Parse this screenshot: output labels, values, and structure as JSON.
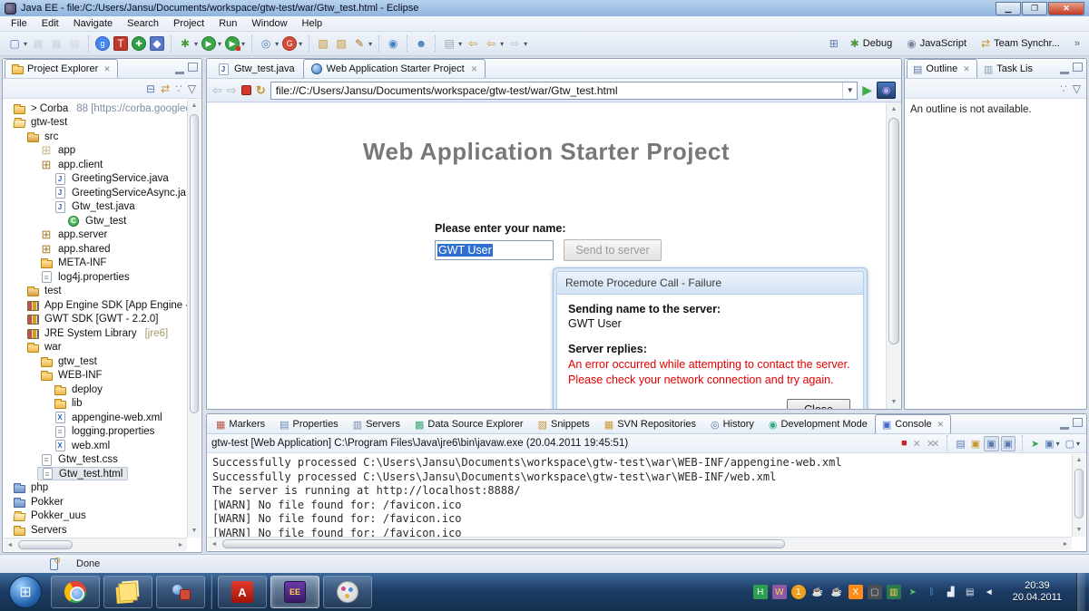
{
  "window": {
    "title": "Java EE - file:/C:/Users/Jansu/Documents/workspace/gtw-test/war/Gtw_test.html - Eclipse"
  },
  "menu_bar": {
    "items": [
      "File",
      "Edit",
      "Navigate",
      "Search",
      "Project",
      "Run",
      "Window",
      "Help"
    ]
  },
  "toolbar": {
    "groups": [
      {
        "items": [
          {
            "name": "new-wizard-icon",
            "glyph": "▢",
            "fg": "#4d7ebb",
            "dropdown": true
          },
          {
            "name": "save-icon",
            "glyph": "▦",
            "fg": "#b9bec6",
            "disabled": true
          },
          {
            "name": "save-all-icon",
            "glyph": "▦",
            "fg": "#b9bec6",
            "disabled": true
          },
          {
            "name": "print-icon",
            "glyph": "▤",
            "fg": "#b9bec6",
            "disabled": true
          }
        ]
      },
      {
        "items": [
          {
            "name": "google-services-icon",
            "glyph": "g",
            "fg": "#ffffff",
            "bg": "#4285f4",
            "round": true
          },
          {
            "name": "gwt-designer-icon",
            "glyph": "T",
            "fg": "#ffffff",
            "bg": "#c0392b"
          },
          {
            "name": "web-test-icon",
            "glyph": "✚",
            "fg": "#ffffff",
            "bg": "#2f9e44",
            "round": true
          },
          {
            "name": "deploy-appengine-icon",
            "glyph": "◆",
            "fg": "#ffffff",
            "bg": "#5577cc"
          }
        ]
      },
      {
        "items": [
          {
            "name": "debug-icon",
            "glyph": "✱",
            "fg": "#4a9a3a",
            "dropdown": true
          },
          {
            "name": "run-icon",
            "glyph": "▶",
            "fg": "#ffffff",
            "bg": "#3aa648",
            "round": true,
            "dropdown": true
          },
          {
            "name": "run-external-tools-icon",
            "glyph": "▶",
            "fg": "#ffffff",
            "bg": "#3aa648",
            "round": true,
            "badge": true,
            "dropdown": true
          }
        ]
      },
      {
        "items": [
          {
            "name": "new-server-icon",
            "glyph": "◎",
            "fg": "#4d7ebb",
            "dropdown": true
          },
          {
            "name": "gwt-compile-icon",
            "glyph": "G",
            "fg": "#ffffff",
            "bg": "#d84a38",
            "round": true,
            "dropdown": true
          }
        ]
      },
      {
        "items": [
          {
            "name": "open-resource-icon",
            "glyph": "▧",
            "fg": "#c6952c"
          },
          {
            "name": "open-type-icon",
            "glyph": "▨",
            "fg": "#c6952c"
          },
          {
            "name": "search-icon",
            "glyph": "✎",
            "fg": "#b5651d",
            "dropdown": true
          }
        ]
      },
      {
        "items": [
          {
            "name": "web-browser-icon",
            "glyph": "◉",
            "fg": "#3f7fbf"
          }
        ]
      },
      {
        "items": [
          {
            "name": "profile-icon",
            "glyph": "☻",
            "fg": "#4d7ebb"
          }
        ]
      },
      {
        "items": [
          {
            "name": "annotation-nav-icon",
            "glyph": "▤",
            "fg": "#9aa5b5",
            "dropdown": true
          },
          {
            "name": "back-history-icon",
            "glyph": "⇦",
            "fg": "#c6952c"
          },
          {
            "name": "back-icon",
            "glyph": "⇦",
            "fg": "#c6952c",
            "dropdown": true
          },
          {
            "name": "forward-icon",
            "glyph": "⇨",
            "fg": "#b9bec6",
            "dropdown": true
          }
        ]
      }
    ],
    "perspectives": {
      "open_perspective_icon": "⊞",
      "items": [
        {
          "label": "Debug",
          "glyph": "✱",
          "color": "#4a9a3a"
        },
        {
          "label": "JavaScript",
          "glyph": "◉",
          "color": "#7a8aa0"
        },
        {
          "label": "Team Synchr...",
          "glyph": "⇄",
          "color": "#c6952c"
        }
      ],
      "overflow": "»"
    }
  },
  "project_explorer": {
    "title": "Project Explorer",
    "toolbar": [
      {
        "name": "collapse-all-icon",
        "glyph": "⊟",
        "color": "#5a7ab0"
      },
      {
        "name": "link-with-editor-icon",
        "glyph": "⇄",
        "color": "#c6952c"
      },
      {
        "name": "view-menu-icon",
        "glyph": "∵",
        "color": "#8a96a6"
      },
      {
        "name": "view-dropdown-icon",
        "glyph": "▽",
        "color": "#667"
      }
    ],
    "tree": [
      {
        "label": "> Corba",
        "decoration": "88 [https://corba.googlec",
        "level": 0,
        "icon": "folder"
      },
      {
        "label": "gtw-test",
        "level": 0,
        "icon": "proj-open"
      },
      {
        "label": "src",
        "level": 1,
        "icon": "src"
      },
      {
        "label": "app",
        "level": 2,
        "icon": "pkg-empty"
      },
      {
        "label": "app.client",
        "level": 2,
        "icon": "pkg"
      },
      {
        "label": "GreetingService.java",
        "level": 3,
        "icon": "jfile"
      },
      {
        "label": "GreetingServiceAsync.ja",
        "level": 3,
        "icon": "jfile"
      },
      {
        "label": "Gtw_test.java",
        "level": 3,
        "icon": "jfile"
      },
      {
        "label": "Gtw_test",
        "level": 4,
        "icon": "class"
      },
      {
        "label": "app.server",
        "level": 2,
        "icon": "pkg"
      },
      {
        "label": "app.shared",
        "level": 2,
        "icon": "pkg"
      },
      {
        "label": "META-INF",
        "level": 2,
        "icon": "folder"
      },
      {
        "label": "log4j.properties",
        "level": 2,
        "icon": "file"
      },
      {
        "label": "test",
        "level": 1,
        "icon": "src"
      },
      {
        "label": "App Engine SDK [App Engine - ",
        "level": 1,
        "icon": "lib"
      },
      {
        "label": "GWT SDK [GWT - 2.2.0]",
        "level": 1,
        "icon": "lib"
      },
      {
        "label": "JRE System Library",
        "decoration": "[jre6]",
        "deco_style": "lib",
        "level": 1,
        "icon": "lib"
      },
      {
        "label": "war",
        "level": 1,
        "icon": "folder"
      },
      {
        "label": "gtw_test",
        "level": 2,
        "icon": "folder"
      },
      {
        "label": "WEB-INF",
        "level": 2,
        "icon": "folder"
      },
      {
        "label": "deploy",
        "level": 3,
        "icon": "folder"
      },
      {
        "label": "lib",
        "level": 3,
        "icon": "folder"
      },
      {
        "label": "appengine-web.xml",
        "level": 3,
        "icon": "xml"
      },
      {
        "label": "logging.properties",
        "level": 3,
        "icon": "file"
      },
      {
        "label": "web.xml",
        "level": 3,
        "icon": "xml"
      },
      {
        "label": "Gtw_test.css",
        "level": 2,
        "icon": "file"
      },
      {
        "label": "Gtw_test.html",
        "level": 2,
        "icon": "file",
        "selected": true
      },
      {
        "label": "php",
        "level": 0,
        "icon": "folder-blue"
      },
      {
        "label": "Pokker",
        "level": 0,
        "icon": "folder-blue"
      },
      {
        "label": "Pokker_uus",
        "level": 0,
        "icon": "proj-open"
      },
      {
        "label": "Servers",
        "level": 0,
        "icon": "folder"
      }
    ]
  },
  "editor": {
    "tabs": [
      {
        "label": "Gtw_test.java",
        "icon": "jfile"
      },
      {
        "label": "Web Application Starter Project",
        "icon": "globe",
        "active": true,
        "closable": true
      }
    ],
    "browser_toolbar": {
      "url": "file://C:/Users/Jansu/Documents/workspace/gtw-test/war/Gtw_test.html"
    },
    "page": {
      "heading": "Web Application Starter Project",
      "name_label": "Please enter your name:",
      "name_value": "GWT User",
      "send_button": "Send to server",
      "dialog": {
        "title": "Remote Procedure Call - Failure",
        "sending_label": "Sending name to the server:",
        "sending_value": "GWT User",
        "replies_label": "Server replies:",
        "error_text": "An error occurred while attempting to contact the server. Please check your network connection and try again.",
        "close_button": "Close"
      }
    }
  },
  "bottom_panel": {
    "tabs": [
      {
        "label": "Markers",
        "glyph": "▦",
        "color": "#bb5544"
      },
      {
        "label": "Properties",
        "glyph": "▤",
        "color": "#6688aa"
      },
      {
        "label": "Servers",
        "glyph": "▥",
        "color": "#7788aa"
      },
      {
        "label": "Data Source Explorer",
        "glyph": "▩",
        "color": "#44aa77"
      },
      {
        "label": "Snippets",
        "glyph": "▨",
        "color": "#cc9933"
      },
      {
        "label": "SVN Repositories",
        "glyph": "▦",
        "color": "#cc9933"
      },
      {
        "label": "History",
        "glyph": "◎",
        "color": "#5577aa"
      },
      {
        "label": "Development Mode",
        "glyph": "◉",
        "color": "#33aa88"
      },
      {
        "label": "Console",
        "glyph": "▣",
        "color": "#4466cc",
        "active": true,
        "closable": true
      }
    ],
    "console_title": "gtw-test [Web Application] C:\\Program Files\\Java\\jre6\\bin\\javaw.exe (20.04.2011 19:45:51)",
    "toolbar": [
      {
        "name": "terminate-icon",
        "glyph": "■",
        "color": "#cc2222"
      },
      {
        "name": "remove-launch-icon",
        "glyph": "✕",
        "color": "#9aa0a8"
      },
      {
        "name": "remove-all-launches-icon",
        "glyph": "✕✕",
        "color": "#9aa0a8",
        "stack": true
      },
      {
        "sep": true
      },
      {
        "name": "clear-console-icon",
        "glyph": "▤",
        "color": "#5a7ab0"
      },
      {
        "name": "scroll-lock-icon",
        "glyph": "▣",
        "color": "#c6952c"
      },
      {
        "name": "show-stdout-icon",
        "glyph": "▣",
        "color": "#5a7ab0",
        "pressed": true
      },
      {
        "name": "show-stderr-icon",
        "glyph": "▣",
        "color": "#5a7ab0",
        "pressed": true
      },
      {
        "sep": true
      },
      {
        "name": "pin-console-icon",
        "glyph": "➤",
        "color": "#3aa648"
      },
      {
        "name": "display-console-icon",
        "glyph": "▣",
        "color": "#5a7ab0",
        "dropdown": true
      },
      {
        "name": "open-console-icon",
        "glyph": "▢",
        "color": "#5a7ab0",
        "dropdown": true
      }
    ],
    "lines": [
      "Successfully processed C:\\Users\\Jansu\\Documents\\workspace\\gtw-test\\war\\WEB-INF/appengine-web.xml",
      "Successfully processed C:\\Users\\Jansu\\Documents\\workspace\\gtw-test\\war\\WEB-INF/web.xml",
      "The server is running at http://localhost:8888/",
      "[WARN] No file found for: /favicon.ico",
      "[WARN] No file found for: /favicon.ico",
      "[WARN] No file found for: /favicon.ico"
    ]
  },
  "outline": {
    "tabs": [
      {
        "label": "Outline",
        "glyph": "▤",
        "color": "#5577aa",
        "active": true,
        "closable": true
      },
      {
        "label": "Task Lis",
        "glyph": "▥",
        "color": "#8899aa"
      }
    ],
    "toolbar": [
      {
        "name": "view-menu-icon",
        "glyph": "∵",
        "color": "#8a96a6"
      },
      {
        "name": "view-dropdown-icon",
        "glyph": "▽",
        "color": "#667"
      }
    ],
    "message": "An outline is not available."
  },
  "status_bar": {
    "text": "Done"
  },
  "taskbar": {
    "start_glyph": "⊞",
    "apps": [
      {
        "name": "chrome"
      },
      {
        "name": "sticky-notes"
      },
      {
        "name": "messenger"
      },
      {
        "name": "divider"
      },
      {
        "name": "adobe-reader",
        "label": "A"
      },
      {
        "name": "eclipse",
        "label": "EE",
        "active": true
      },
      {
        "name": "paint"
      }
    ],
    "tray": [
      {
        "name": "hdd-health-icon",
        "glyph": "H",
        "bg": "#2e9e4f",
        "fg": "#ffffff"
      },
      {
        "name": "winrar-icon",
        "glyph": "W",
        "bg": "#8a5aa8",
        "fg": "#ffd24a"
      },
      {
        "name": "currency-icon",
        "glyph": "1",
        "bg": "#f0a020",
        "fg": "#ffffff",
        "round": true
      },
      {
        "name": "java-update-icon",
        "glyph": "☕",
        "fg": "#dde4ec"
      },
      {
        "name": "java-icon",
        "glyph": "☕",
        "fg": "#dde4ec"
      },
      {
        "name": "xampp-icon",
        "glyph": "X",
        "bg": "#ff8c1a",
        "fg": "#ffffff"
      },
      {
        "name": "display-icon",
        "glyph": "▢",
        "bg": "#4a4f57",
        "fg": "#cfd4da"
      },
      {
        "name": "resource-monitor-icon",
        "glyph": "▥",
        "bg": "#2a7a4f",
        "fg": "#ffd24a"
      },
      {
        "name": "updater-icon",
        "glyph": "➤",
        "fg": "#58c05e"
      },
      {
        "name": "bluetooth-icon",
        "glyph": "ᛒ",
        "fg": "#63a8e8"
      },
      {
        "name": "network-signal-icon",
        "glyph": "▟",
        "fg": "#e8edf3"
      },
      {
        "name": "action-center-icon",
        "glyph": "▤",
        "fg": "#dfe5ec"
      },
      {
        "name": "volume-icon",
        "glyph": "◄",
        "fg": "#e8edf3"
      }
    ],
    "clock_time": "20:39",
    "clock_date": "20.04.2011"
  }
}
